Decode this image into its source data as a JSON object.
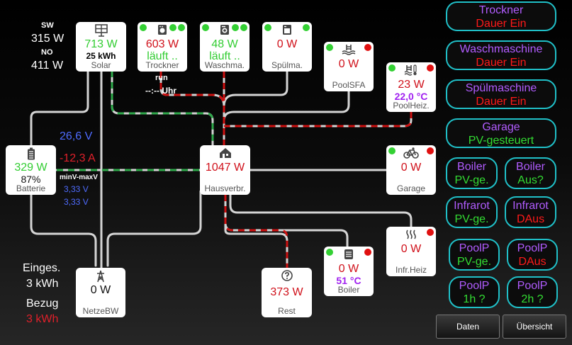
{
  "colors": {
    "green": "#32cd32",
    "red": "#d0101a",
    "purple": "#a020f0",
    "blue": "#4f6cff",
    "accent": "#20c0c8"
  },
  "solar": {
    "sw_label": "SW",
    "sw_value": "315 W",
    "no_label": "NO",
    "no_value": "411 W",
    "value": "713 W",
    "energy": "25 kWh",
    "label": "Solar",
    "icon": "solar-panel-icon"
  },
  "trockner": {
    "value": "603 W",
    "status": "läuft ..",
    "label": "Trockner",
    "run_label": "run",
    "time": "--:-- Uhr",
    "icon": "dryer-icon"
  },
  "waschma": {
    "value": "48 W",
    "status": "läuft ..",
    "label": "Waschma.",
    "icon": "washing-machine-icon"
  },
  "spuelma": {
    "value": "0 W",
    "label": "Spülma.",
    "icon": "dishwasher-icon"
  },
  "poolsfa": {
    "value": "0 W",
    "label": "PoolSFA",
    "icon": "pool-icon"
  },
  "poolheiz": {
    "value": "23 W",
    "temp": "22,0 °C",
    "label": "PoolHeiz.",
    "icon": "pool-heater-icon"
  },
  "batterie": {
    "value": "329 W",
    "percent": "87%",
    "label": "Batterie",
    "voltage": "26,6 V",
    "current": "-12,3 A",
    "minmax_label": "minV-maxV",
    "min_v": "3,33 V",
    "max_v": "3,33 V",
    "icon": "battery-icon"
  },
  "haus": {
    "value": "1047 W",
    "label": "Hausverbr.",
    "icon": "house-icon"
  },
  "garage": {
    "value": "0 W",
    "label": "Garage",
    "icon": "bike-icon"
  },
  "infrarot": {
    "value": "0 W",
    "label": "Infr.Heiz",
    "icon": "heat-icon"
  },
  "boiler": {
    "value": "0 W",
    "temp": "51 °C",
    "label": "Boiler",
    "icon": "boiler-icon"
  },
  "rest": {
    "value": "373 W",
    "label": "Rest",
    "icon": "question-icon"
  },
  "netz": {
    "value": "0 W",
    "label": "NetzeBW",
    "icon": "power-pylon-icon"
  },
  "totals": {
    "einges_label": "Einges.",
    "einges_value": "3 kWh",
    "bezug_label": "Bezug",
    "bezug_value": "3 kWh"
  },
  "controls": [
    {
      "title": "Trockner",
      "state": "Dauer Ein",
      "state_color": "red"
    },
    {
      "title": "Waschmaschine",
      "state": "Dauer Ein",
      "state_color": "red"
    },
    {
      "title": "Spülmaschine",
      "state": "Dauer Ein",
      "state_color": "red"
    },
    {
      "title": "Garage",
      "state": "PV-gesteuert",
      "state_color": "green"
    },
    {
      "title": "Boiler",
      "state": "PV-ge.",
      "state_color": "green"
    },
    {
      "title": "Boiler",
      "state": "Aus?",
      "state_color": "green"
    },
    {
      "title": "Infrarot",
      "state": "PV-ge.",
      "state_color": "green"
    },
    {
      "title": "Infrarot",
      "state": "DAus",
      "state_color": "red"
    },
    {
      "title": "PoolP",
      "state": "PV-ge.",
      "state_color": "green"
    },
    {
      "title": "PoolP",
      "state": "DAus",
      "state_color": "red"
    },
    {
      "title": "PoolP",
      "state": "1h ?",
      "state_color": "green"
    },
    {
      "title": "PoolP",
      "state": "2h ?",
      "state_color": "green"
    }
  ],
  "buttons": {
    "daten": "Daten",
    "uebersicht": "Übersicht"
  }
}
